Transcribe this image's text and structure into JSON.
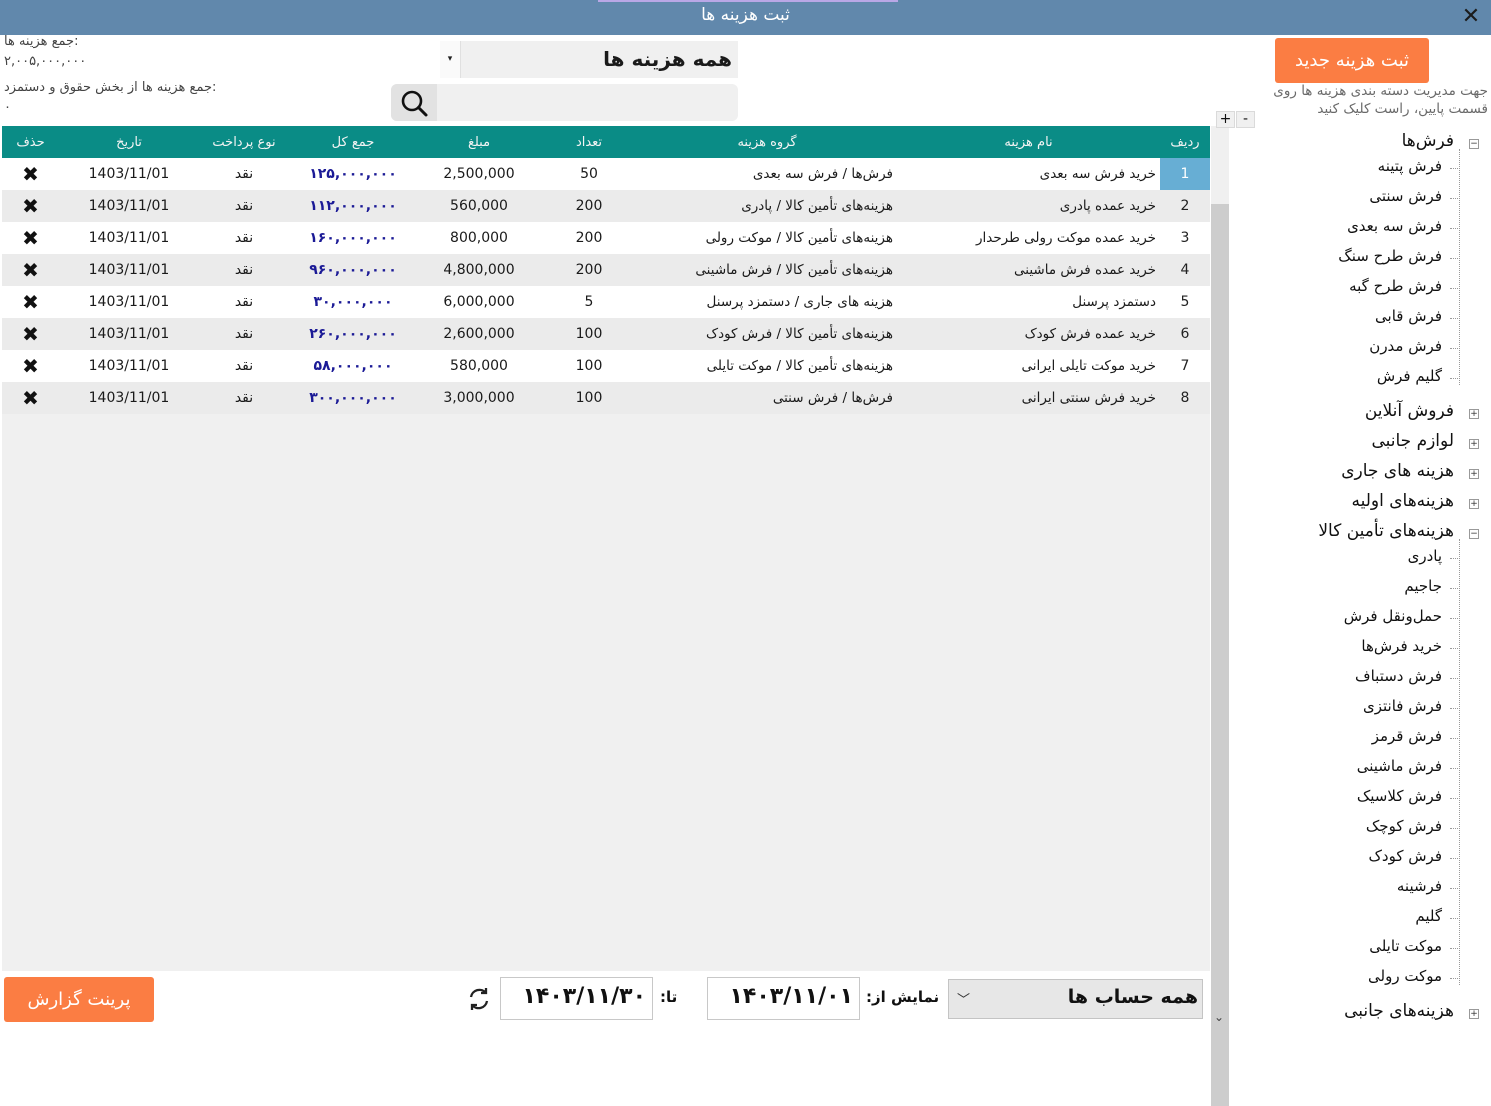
{
  "window": {
    "title": "ثبت هزینه ها",
    "close_glyph": "✕"
  },
  "totals": {
    "label_all": "جمع هزینه ها:",
    "value_all": "۲,۰۰۵,۰۰۰,۰۰۰",
    "label_salary": "جمع هزینه ها از بخش حقوق و دستمزد:",
    "value_salary": "۰"
  },
  "filter": {
    "category_value": "همه هزینه ها",
    "search_placeholder": ""
  },
  "table": {
    "headers": {
      "row": "ردیف",
      "name": "نام هزینه",
      "group": "گروه هزینه",
      "qty": "تعداد",
      "amount": "مبلغ",
      "total": "جمع کل",
      "pay": "نوع پرداخت",
      "date": "تاریخ",
      "del": "حذف"
    },
    "rows": [
      {
        "row": "1",
        "name": "خرید فرش سه بعدی",
        "group": "فرش‌ها / فرش سه بعدی",
        "qty": "50",
        "amount": "2,500,000",
        "total": "۱۲۵,۰۰۰,۰۰۰",
        "pay": "نقد",
        "date": "1403/11/01",
        "del": "✖"
      },
      {
        "row": "2",
        "name": "خرید عمده پادری",
        "group": "هزینه‌های تأمین کالا / پادری",
        "qty": "200",
        "amount": "560,000",
        "total": "۱۱۲,۰۰۰,۰۰۰",
        "pay": "نقد",
        "date": "1403/11/01",
        "del": "✖"
      },
      {
        "row": "3",
        "name": "خرید عمده موکت رولی طرحدار",
        "group": "هزینه‌های تأمین کالا / موکت رولی",
        "qty": "200",
        "amount": "800,000",
        "total": "۱۶۰,۰۰۰,۰۰۰",
        "pay": "نقد",
        "date": "1403/11/01",
        "del": "✖"
      },
      {
        "row": "4",
        "name": "خرید عمده فرش ماشینی",
        "group": "هزینه‌های تأمین کالا / فرش ماشینی",
        "qty": "200",
        "amount": "4,800,000",
        "total": "۹۶۰,۰۰۰,۰۰۰",
        "pay": "نقد",
        "date": "1403/11/01",
        "del": "✖"
      },
      {
        "row": "5",
        "name": "دستمزد پرسنل",
        "group": "هزینه های جاری / دستمزد پرسنل",
        "qty": "5",
        "amount": "6,000,000",
        "total": "۳۰,۰۰۰,۰۰۰",
        "pay": "نقد",
        "date": "1403/11/01",
        "del": "✖"
      },
      {
        "row": "6",
        "name": "خرید عمده فرش کودک",
        "group": "هزینه‌های تأمین کالا / فرش کودک",
        "qty": "100",
        "amount": "2,600,000",
        "total": "۲۶۰,۰۰۰,۰۰۰",
        "pay": "نقد",
        "date": "1403/11/01",
        "del": "✖"
      },
      {
        "row": "7",
        "name": "خرید موکت تایلی ایرانی",
        "group": "هزینه‌های تأمین کالا / موکت تایلی",
        "qty": "100",
        "amount": "580,000",
        "total": "۵۸,۰۰۰,۰۰۰",
        "pay": "نقد",
        "date": "1403/11/01",
        "del": "✖"
      },
      {
        "row": "8",
        "name": "خرید فرش سنتی ایرانی",
        "group": "فرش‌ها / فرش سنتی",
        "qty": "100",
        "amount": "3,000,000",
        "total": "۳۰۰,۰۰۰,۰۰۰",
        "pay": "نقد",
        "date": "1403/11/01",
        "del": "✖"
      }
    ]
  },
  "panel": {
    "new_button": "ثبت هزینه جدید",
    "hint": "جهت مدیریت دسته بندی هزینه ها روی قسمت پایین، راست کلیک کنید",
    "expand_all": "+",
    "collapse_all": "-",
    "tree": [
      {
        "label": "فرش‌ها",
        "expanded": true,
        "box": "−",
        "children": [
          "فرش پتینه",
          "فرش سنتی",
          "فرش سه بعدی",
          "فرش طرح سنگ",
          "فرش طرح گبه",
          "فرش قابی",
          "فرش مدرن",
          "گلیم فرش"
        ]
      },
      {
        "label": "فروش آنلاین",
        "expanded": false,
        "box": "+",
        "children": []
      },
      {
        "label": "لوازم جانبی",
        "expanded": false,
        "box": "+",
        "children": []
      },
      {
        "label": "هزینه های جاری",
        "expanded": false,
        "box": "+",
        "children": []
      },
      {
        "label": "هزینه‌های اولیه",
        "expanded": false,
        "box": "+",
        "children": []
      },
      {
        "label": "هزینه‌های تأمین کالا",
        "expanded": true,
        "box": "−",
        "children": [
          "پادری",
          "جاجیم",
          "حمل‌ونقل فرش",
          "خرید فرش‌ها",
          "فرش دستباف",
          "فرش فانتزی",
          "فرش قرمز",
          "فرش ماشینی",
          "فرش کلاسیک",
          "فرش کوچک",
          "فرش کودک",
          "فرشینه",
          "گلیم",
          "موکت تایلی",
          "موکت رولی"
        ]
      },
      {
        "label": "هزینه‌های جانبی",
        "expanded": false,
        "box": "+",
        "children": []
      }
    ]
  },
  "footer": {
    "print_button": "پرینت گزارش",
    "to_label": "تا:",
    "to_value": "۱۴۰۳/۱۱/۳۰",
    "from_label": "نمایش از:",
    "from_value": "۱۴۰۳/۱۱/۰۱",
    "account_value": "همه حساب ها"
  },
  "colors": {
    "titlebar": "#6188ac",
    "header": "#0a8c86",
    "accent_button": "#fb7d43",
    "total_text": "#1b1a96",
    "selected_row_index": "#67aed4"
  }
}
